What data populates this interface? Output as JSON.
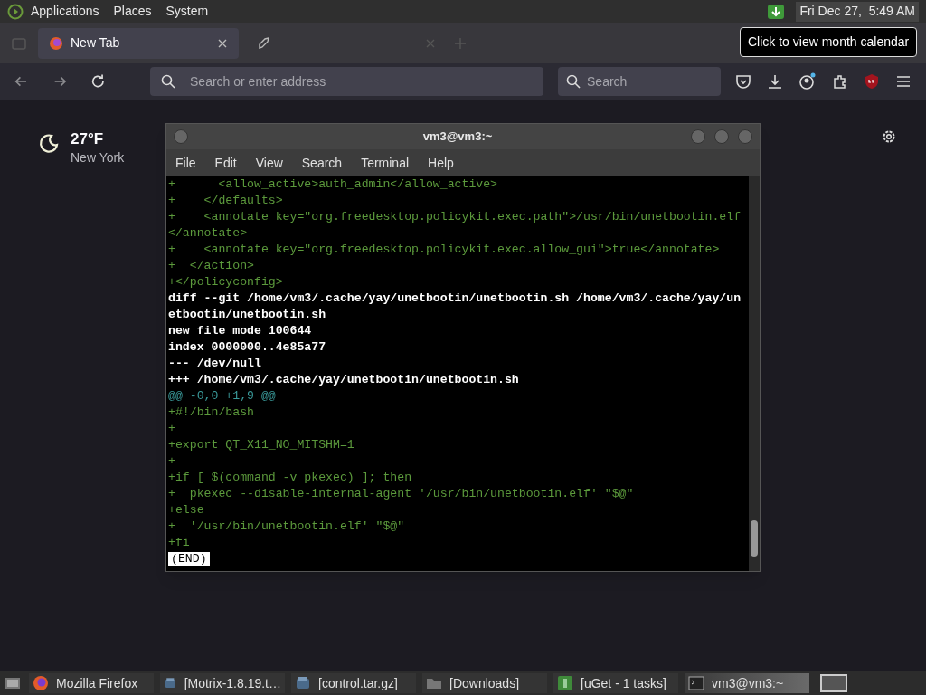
{
  "top_panel": {
    "menus": [
      "Applications",
      "Places",
      "System"
    ],
    "clock": "Fri Dec 27,  5:49 AM",
    "tooltip": "Click to view month calendar"
  },
  "browser": {
    "tabs": [
      {
        "label": "New Tab",
        "selected": true
      },
      {
        "selected": false
      }
    ],
    "address_placeholder": "Search or enter address",
    "search_placeholder": "Search"
  },
  "weather": {
    "temperature": "27°F",
    "city": "New York"
  },
  "terminal": {
    "title": "vm3@vm3:~",
    "menus": [
      "File",
      "Edit",
      "View",
      "Search",
      "Terminal",
      "Help"
    ],
    "lines": [
      {
        "kind": "added",
        "text": "+      <allow_active>auth_admin</allow_active>"
      },
      {
        "kind": "added",
        "text": "+    </defaults>"
      },
      {
        "kind": "added",
        "text": "+    <annotate key=\"org.freedesktop.policykit.exec.path\">/usr/bin/unetbootin.elf"
      },
      {
        "kind": "added",
        "text": "</annotate>"
      },
      {
        "kind": "added",
        "text": "+    <annotate key=\"org.freedesktop.policykit.exec.allow_gui\">true</annotate>"
      },
      {
        "kind": "added",
        "text": "+  </action>"
      },
      {
        "kind": "added",
        "text": "+</policyconfig>"
      },
      {
        "kind": "header",
        "text": "diff --git /home/vm3/.cache/yay/unetbootin/unetbootin.sh /home/vm3/.cache/yay/un"
      },
      {
        "kind": "header",
        "text": "etbootin/unetbootin.sh"
      },
      {
        "kind": "header",
        "text": "new file mode 100644"
      },
      {
        "kind": "header",
        "text": "index 0000000..4e85a77"
      },
      {
        "kind": "header",
        "text": "--- /dev/null"
      },
      {
        "kind": "header",
        "text": "+++ /home/vm3/.cache/yay/unetbootin/unetbootin.sh"
      },
      {
        "kind": "hunk",
        "text": "@@ -0,0 +1,9 @@"
      },
      {
        "kind": "added",
        "text": "+#!/bin/bash"
      },
      {
        "kind": "added",
        "text": "+"
      },
      {
        "kind": "added",
        "text": "+export QT_X11_NO_MITSHM=1"
      },
      {
        "kind": "added",
        "text": "+"
      },
      {
        "kind": "added",
        "text": "+if [ $(command -v pkexec) ]; then"
      },
      {
        "kind": "added",
        "text": "+  pkexec --disable-internal-agent '/usr/bin/unetbootin.elf' \"$@\""
      },
      {
        "kind": "added",
        "text": "+else"
      },
      {
        "kind": "added",
        "text": "+  '/usr/bin/unetbootin.elf' \"$@\""
      },
      {
        "kind": "added",
        "text": "+fi"
      },
      {
        "kind": "pager",
        "text": "(END)"
      }
    ]
  },
  "taskbar": [
    {
      "label": "Mozilla Firefox",
      "kind": "firefox",
      "selected": false
    },
    {
      "label": "[Motrix-1.8.19.t…",
      "kind": "archive",
      "selected": false
    },
    {
      "label": "[control.tar.gz]",
      "kind": "archive",
      "selected": false
    },
    {
      "label": "[Downloads]",
      "kind": "folder",
      "selected": false
    },
    {
      "label": "[uGet - 1 tasks]",
      "kind": "uget",
      "selected": false
    },
    {
      "label": "vm3@vm3:~",
      "kind": "terminal",
      "selected": true
    }
  ]
}
